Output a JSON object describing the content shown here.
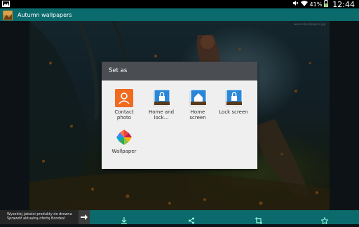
{
  "status_bar": {
    "battery": "41%",
    "time": "12:44"
  },
  "app": {
    "title": "Autumn wallpapers"
  },
  "wallpaper": {
    "watermark": "www.hdwallpapers.jpg"
  },
  "dialog": {
    "title": "Set as",
    "options": [
      {
        "label": "Contact photo",
        "icon": "contact-icon"
      },
      {
        "label": "Home and lock...",
        "icon": "home-lock-icon"
      },
      {
        "label": "Home screen",
        "icon": "home-icon"
      },
      {
        "label": "Lock screen",
        "icon": "lock-icon"
      },
      {
        "label": "Wallpaper",
        "icon": "photos-pinwheel-icon"
      }
    ]
  },
  "ad": {
    "text": "Wysokiej jakości produkty do drewna Sprawdź aktualną ofertę Bondex!"
  },
  "bottom_bar": {
    "icons": [
      "download-icon",
      "share-icon",
      "crop-icon",
      "star-icon"
    ]
  },
  "colors": {
    "accent": "#0b6a6c",
    "dialog_header": "#4a4d52",
    "contact_orange": "#f06a20",
    "blue_tile": "#2a87d8"
  }
}
